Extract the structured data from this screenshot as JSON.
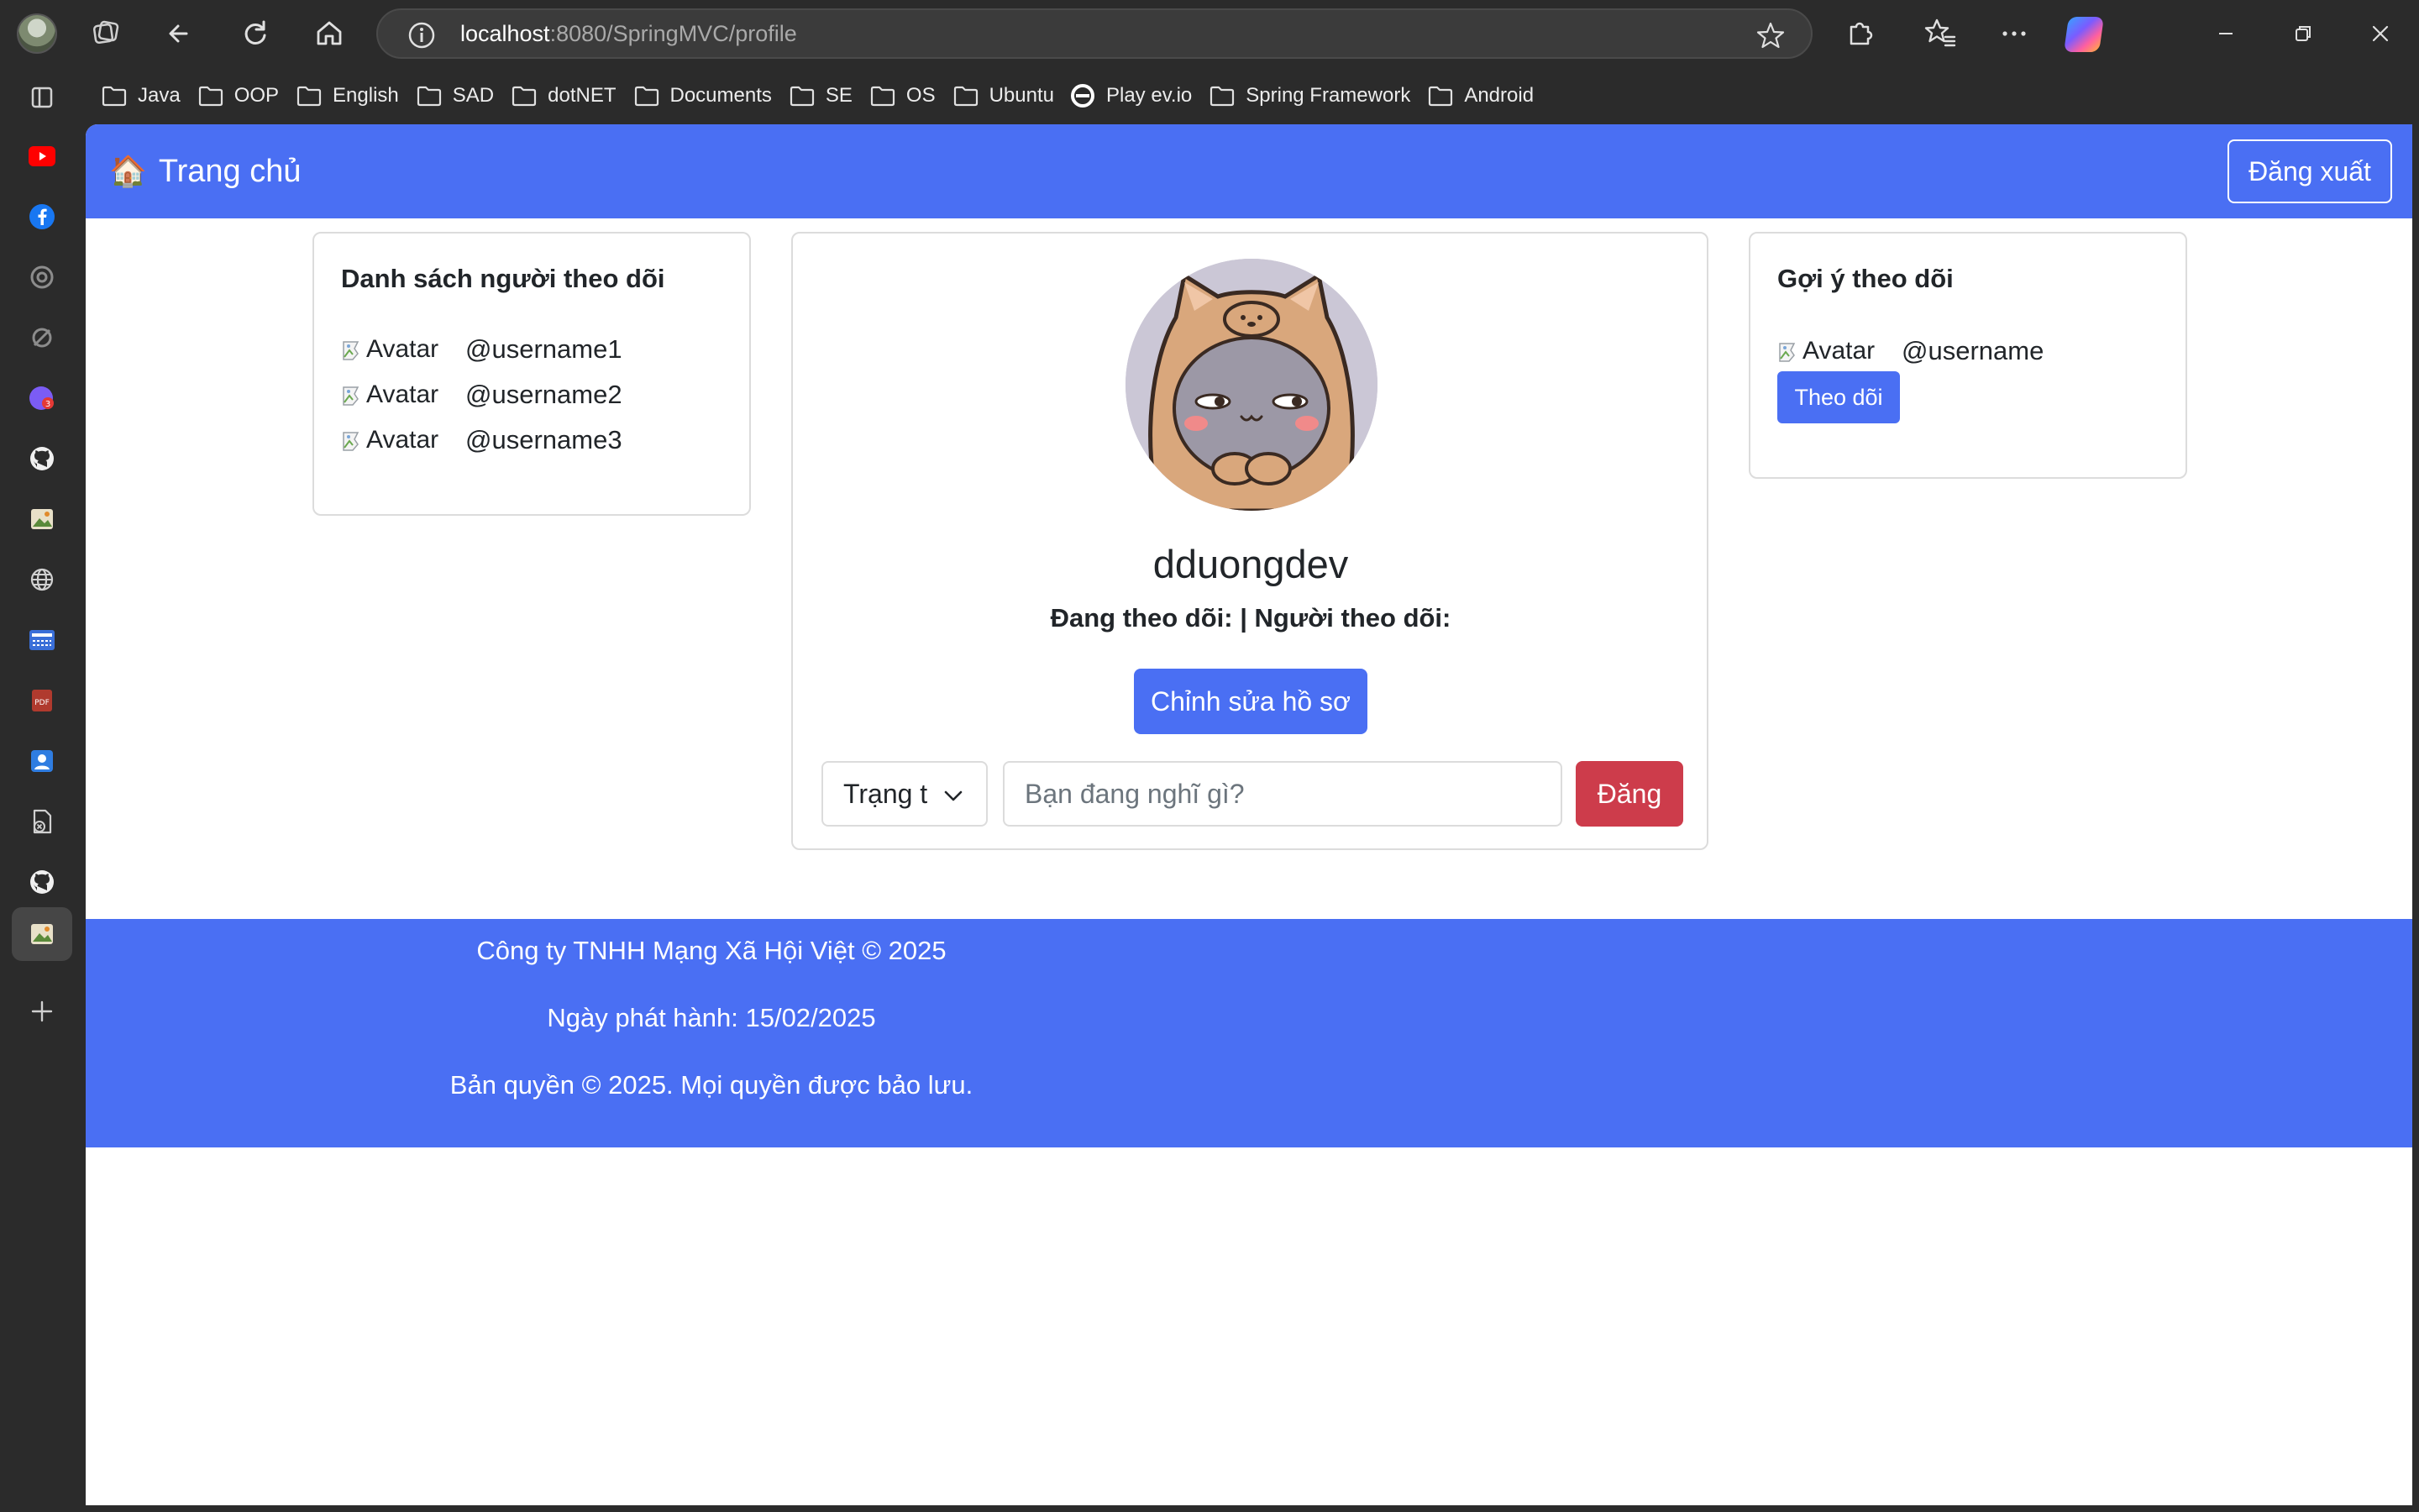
{
  "browser": {
    "url_host": "localhost",
    "url_rest": ":8080/SpringMVC/profile",
    "toolbar_icons": [
      "profile-avatar",
      "tab-actions-icon",
      "back-icon",
      "refresh-icon",
      "home-icon",
      "site-info-icon",
      "favorite-star-icon",
      "extensions-icon",
      "favorites-icon",
      "more-icon",
      "copilot-icon",
      "minimize-icon",
      "restore-icon",
      "close-icon"
    ]
  },
  "bookmarks": [
    {
      "label": "Java",
      "icon": "folder-icon"
    },
    {
      "label": "OOP",
      "icon": "folder-icon"
    },
    {
      "label": "English",
      "icon": "folder-icon"
    },
    {
      "label": "SAD",
      "icon": "folder-icon"
    },
    {
      "label": "dotNET",
      "icon": "folder-icon"
    },
    {
      "label": "Documents",
      "icon": "folder-icon"
    },
    {
      "label": "SE",
      "icon": "folder-icon"
    },
    {
      "label": "OS",
      "icon": "folder-icon"
    },
    {
      "label": "Ubuntu",
      "icon": "folder-icon"
    },
    {
      "label": "Play ev.io",
      "icon": "evio-icon"
    },
    {
      "label": "Spring Framework",
      "icon": "folder-icon"
    },
    {
      "label": "Android",
      "icon": "folder-icon"
    }
  ],
  "sidebar_icons": [
    "tab-panel-icon",
    "youtube-icon",
    "facebook-icon",
    "openai-icon",
    "edge-shopping-icon",
    "messenger-icon",
    "github-icon",
    "image-app-icon",
    "globe-icon",
    "keyboard-app-icon",
    "pdf-icon",
    "contacts-icon",
    "file-x-icon",
    "github-icon",
    "image-app-icon",
    "add-icon"
  ],
  "navbar": {
    "brand_icon": "🏠",
    "brand": "Trang chủ",
    "logout": "Đăng xuất"
  },
  "followers": {
    "title": "Danh sách người theo dõi",
    "items": [
      {
        "alt": "Avatar",
        "username": "@username1"
      },
      {
        "alt": "Avatar",
        "username": "@username2"
      },
      {
        "alt": "Avatar",
        "username": "@username3"
      }
    ]
  },
  "profile": {
    "username": "dduongdev",
    "stats": "Đang theo dõi: | Người theo dõi:",
    "edit_button": "Chỉnh sửa hồ sơ",
    "status_select": "Trạng t",
    "post_placeholder": "Bạn đang nghĩ gì?",
    "post_button": "Đăng"
  },
  "suggestions": {
    "title": "Gợi ý theo dõi",
    "items": [
      {
        "alt": "Avatar",
        "username": "@username",
        "follow": "Theo dõi"
      }
    ]
  },
  "footer": {
    "line1": "Công ty TNHH Mạng Xã Hội Việt © 2025",
    "line2": "Ngày phát hành: 15/02/2025",
    "line3": "Bản quyền © 2025. Mọi quyền được bảo lưu."
  },
  "colors": {
    "primary": "#4a6ff3",
    "danger": "#cd3c4b",
    "chrome": "#2b2b2b"
  }
}
